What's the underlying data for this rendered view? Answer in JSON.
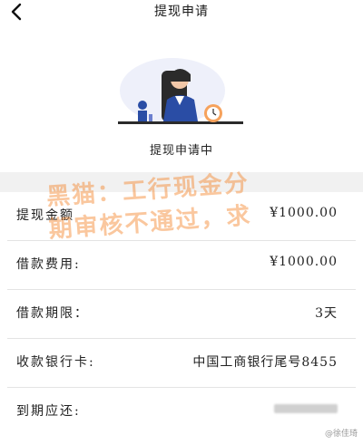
{
  "header": {
    "title": "提现申请",
    "back_icon": "chevron-left-icon"
  },
  "status": {
    "text": "提现申请中"
  },
  "details": [
    {
      "label": "提现金额",
      "value": "¥1000.00"
    },
    {
      "label": "借款费用:",
      "value": "¥1000.00"
    },
    {
      "label": "借款期限：",
      "value": "3天"
    },
    {
      "label": "收款银行卡:",
      "value": "中国工商银行尾号8455"
    },
    {
      "label": "到期应还:",
      "value": ""
    }
  ],
  "watermark": {
    "line1": "黑猫：工行现金分",
    "line2": "期审核不通过，求"
  },
  "credit": "@徐佳琦",
  "colors": {
    "accent": "#f6a25c",
    "lady_top": "#2a4da5",
    "watermark": "#f58228"
  }
}
